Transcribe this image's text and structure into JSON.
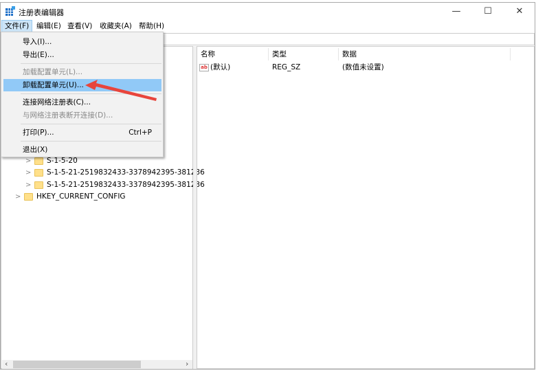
{
  "window": {
    "title": "注册表编辑器",
    "minimize": "—",
    "maximize": "☐",
    "close": "✕"
  },
  "menubar": [
    "文件(F)",
    "编辑(E)",
    "查看(V)",
    "收藏夹(A)",
    "帮助(H)"
  ],
  "file_menu": [
    {
      "label": "导入(I)...",
      "enabled": true
    },
    {
      "label": "导出(E)...",
      "enabled": true
    },
    {
      "label": "加载配置单元(L)...",
      "enabled": false
    },
    {
      "label": "卸载配置单元(U)...",
      "enabled": true,
      "highlighted": true
    },
    {
      "label": "连接网络注册表(C)...",
      "enabled": true
    },
    {
      "label": "与网络注册表断开连接(D)...",
      "enabled": false
    },
    {
      "label": "打印(P)...",
      "enabled": true,
      "shortcut": "Ctrl+P"
    },
    {
      "label": "退出(X)",
      "enabled": true
    }
  ],
  "tree": [
    {
      "label": "S-1-5-20",
      "level": 2
    },
    {
      "label": "S-1-5-21-2519832433-3378942395-381236",
      "level": 2
    },
    {
      "label": "S-1-5-21-2519832433-3378942395-381236",
      "level": 2
    },
    {
      "label": "HKEY_CURRENT_CONFIG",
      "level": 1
    }
  ],
  "list": {
    "columns": [
      "名称",
      "类型",
      "数据"
    ],
    "rows": [
      {
        "name": "(默认)",
        "type": "REG_SZ",
        "data": "(数值未设置)",
        "icon": "string-value-icon"
      }
    ]
  },
  "annotation": {
    "color": "#e8453c"
  }
}
